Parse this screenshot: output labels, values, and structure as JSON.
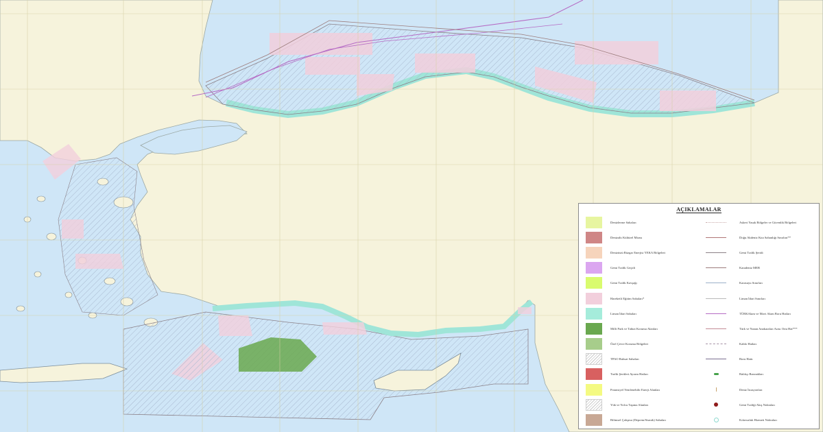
{
  "legend": {
    "title": "AÇIKLAMALAR",
    "area_items": [
      {
        "label": "Denizlerme Sahaları",
        "color": "#e7f5a0",
        "pattern": "solid"
      },
      {
        "label": "Denizaltı Kültürel Mirası",
        "color": "#cf8686",
        "pattern": "solid"
      },
      {
        "label": "Denizüstü Rüzgar Enerjisi YEKA Bölgeleri",
        "color": "#f6d4bc",
        "pattern": "solid"
      },
      {
        "label": "Gemi Trafik Geçidi",
        "color": "#dba6f0",
        "pattern": "solid"
      },
      {
        "label": "Gemi Trafik Kavşağı",
        "color": "#d9fb6e",
        "pattern": "solid"
      },
      {
        "label": "Hareketli Eğitim Sahaları*",
        "color": "#f2cfdc",
        "pattern": "solid"
      },
      {
        "label": "Liman İdari Sahaları",
        "color": "#a5ecdb",
        "pattern": "solid"
      },
      {
        "label": "Milli Park ve Tabiat Koruma Alanları",
        "color": "#6aa84f",
        "pattern": "solid"
      },
      {
        "label": "Özel Çevre Koruma Bölgeleri",
        "color": "#a7cd8b",
        "pattern": "solid"
      },
      {
        "label": "TPAO Ruhsat Sahaları",
        "color": "#ffffff",
        "pattern": "hatch"
      },
      {
        "label": "Trafik Şeritleri Ayırım Hatları",
        "color": "#d86060",
        "pattern": "solid"
      },
      {
        "label": "Potansiyel Yenilenebilir Enerji Alanları",
        "color": "#f4fa82",
        "pattern": "solid"
      },
      {
        "label": "Yük ve Yolcu Taşıma Alanları",
        "color": "#eef3f6",
        "pattern": "hatch-light"
      },
      {
        "label": "Bilimsel Çalışma (Deprem/Sismik) Sahaları",
        "color": "#c8a895",
        "pattern": "solid"
      }
    ],
    "line_items": [
      {
        "label": "Askeri Yasak Bölgeler ve Güvenlik Bölgeleri",
        "color": "#c9a9a9",
        "style": "dotted",
        "symbol": "line"
      },
      {
        "label": "Doğu Akdeniz Kıta Sahanlığı Sınırları**",
        "color": "#b07575",
        "style": "solid",
        "symbol": "line"
      },
      {
        "label": "Gemi Trafik Şeridi",
        "color": "#8a7f86",
        "style": "solid",
        "symbol": "line"
      },
      {
        "label": "Karadeniz MEB",
        "color": "#9c7b7b",
        "style": "solid",
        "symbol": "line"
      },
      {
        "label": "Karasuyu Sınırları",
        "color": "#9ab0c8",
        "style": "solid",
        "symbol": "line"
      },
      {
        "label": "Liman İdari Sınırları",
        "color": "#b9b9b9",
        "style": "solid",
        "symbol": "line"
      },
      {
        "label": "TÜRKAkım ve Mavi Akım Boru Hatları",
        "color": "#b56ac4",
        "style": "solid",
        "symbol": "line"
      },
      {
        "label": "Türk ve Yunan Anakaraları Arası Orta Hat***",
        "color": "#c28a95",
        "style": "solid",
        "symbol": "line"
      },
      {
        "label": "Kablo Hatları",
        "color": "#a591a5",
        "style": "dashed",
        "symbol": "line"
      },
      {
        "label": "Boru Hattı",
        "color": "#7a6f90",
        "style": "solid",
        "symbol": "line"
      },
      {
        "label": "Balıkçı Barınakları",
        "color": "#46a14a",
        "style": "none",
        "symbol": "fish"
      },
      {
        "label": "Deniz İstasyonları",
        "color": "#c7a26a",
        "style": "none",
        "symbol": "pin"
      },
      {
        "label": "Gemi Trafiği Akış Noktaları",
        "color": "#8f1a1a",
        "style": "none",
        "symbol": "dot"
      },
      {
        "label": "Kılavuzluk Hizmeti Noktaları",
        "color": "#8fd9cf",
        "style": "none",
        "symbol": "ring"
      }
    ]
  },
  "colors": {
    "sea": "#cfe6f7",
    "land": "#f6f3dc",
    "coast_band": "#9fe5d8",
    "border": "#7a7a7a",
    "grid": "#d6cfa5"
  }
}
